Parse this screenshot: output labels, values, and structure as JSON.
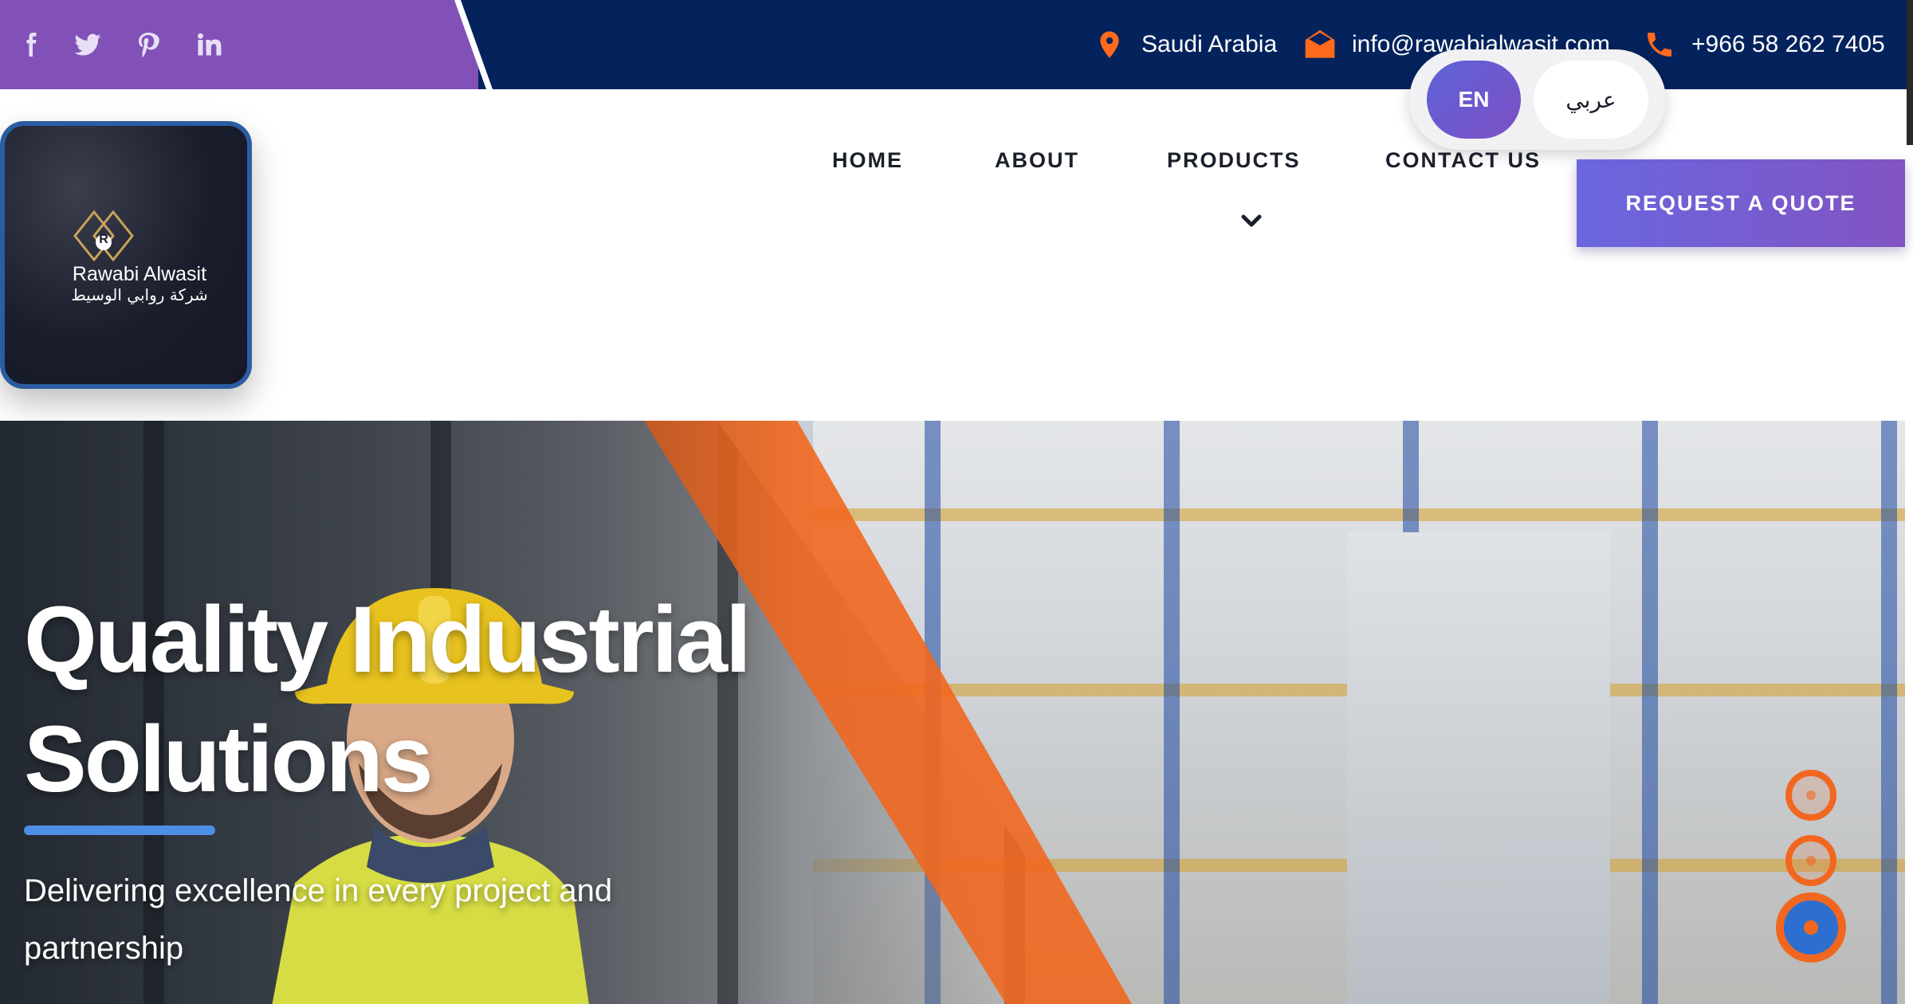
{
  "topbar": {
    "social": [
      "facebook-icon",
      "twitter-icon",
      "pinterest-icon",
      "linkedin-icon"
    ],
    "location": "Saudi Arabia",
    "email": "info@rawabialwasit.com",
    "phone": "+966 58 262 7405"
  },
  "language": {
    "en_label": "EN",
    "ar_label": "عربي"
  },
  "logo": {
    "letter": "R",
    "name": "Rawabi Alwasit",
    "arabic_name": "شركة روابي الوسيط"
  },
  "nav": {
    "home": "HOME",
    "about": "ABOUT",
    "products": "PRODUCTS",
    "contact": "CONTACT US",
    "quote_button": "REQUEST A QUOTE"
  },
  "hero": {
    "title_line1": "Quality Industrial",
    "title_line2": "Solutions",
    "subtitle_line1": "Delivering excellence in every project and",
    "subtitle_line2": "partnership",
    "active_slide": 3,
    "slide_count": 3
  },
  "colors": {
    "topbar": "#04235d",
    "social_strip": "#8151b7",
    "accent_orange": "#f1671f",
    "button_gradient_start": "#6a66df",
    "button_gradient_end": "#8154c2",
    "hero_underline": "#4d8ee6"
  }
}
